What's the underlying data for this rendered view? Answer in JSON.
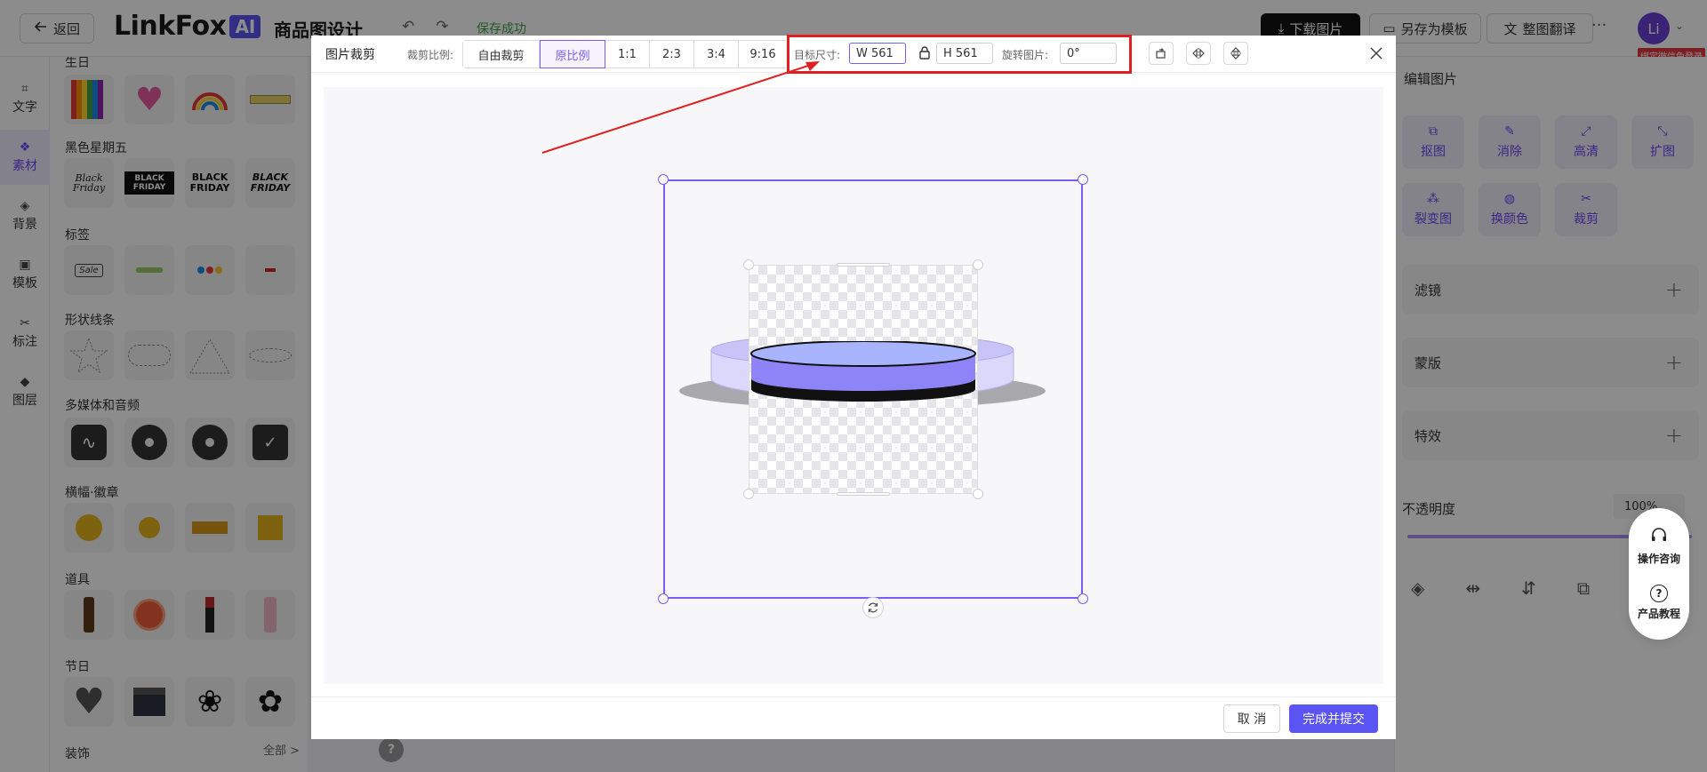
{
  "header": {
    "back_label": "返回",
    "logo_text": "LinkFox",
    "logo_badge": "AI",
    "app_title": "商品图设计",
    "save_status": "保存成功",
    "download_label": "下载图片",
    "save_template_label": "另存为模板",
    "translate_label": "整图翻译",
    "more_label": "···",
    "avatar_letter": "Li",
    "bind_badge": "绑定微信免登录"
  },
  "rail": {
    "items": [
      {
        "label": "文字",
        "icon": "text-icon"
      },
      {
        "label": "素材",
        "icon": "material-icon",
        "active": true
      },
      {
        "label": "背景",
        "icon": "background-icon"
      },
      {
        "label": "模板",
        "icon": "template-icon"
      },
      {
        "label": "标注",
        "icon": "annotate-icon"
      },
      {
        "label": "图层",
        "icon": "layers-icon"
      }
    ]
  },
  "assets": {
    "categories": [
      "生日",
      "黑色星期五",
      "标签",
      "形状线条",
      "多媒体和音频",
      "横幅·徽章",
      "道具",
      "节日",
      "装饰"
    ],
    "footer_all": "全部 >",
    "black_friday_text": "BLACK FRIDAY",
    "black_friday_script": "Black Friday",
    "sale_tag": "Sale"
  },
  "right_panel": {
    "title": "编辑图片",
    "tools": [
      "抠图",
      "消除",
      "高清",
      "扩图",
      "裂变图",
      "换颜色",
      "裁剪"
    ],
    "accordions": [
      "滤镜",
      "蒙版",
      "特效"
    ],
    "opacity_label": "不透明度",
    "opacity_value": "100%"
  },
  "float_help": {
    "consult_label": "操作咨询",
    "tutorial_label": "产品教程"
  },
  "crop_modal": {
    "title": "图片裁剪",
    "ratio_label": "裁剪比例:",
    "ratios": [
      "自由裁剪",
      "原比例",
      "1:1",
      "2:3",
      "3:4",
      "9:16"
    ],
    "active_ratio": "原比例",
    "target_size_label": "目标尺寸:",
    "width_value": "W 561",
    "height_value": "H 561",
    "rotate_label": "旋转图片:",
    "rotate_value": "0°",
    "cancel_label": "取 消",
    "submit_label": "完成并提交"
  },
  "colors": {
    "accent": "#7c5cf5",
    "primary_button": "#5b54f5",
    "highlight_box": "#e02020",
    "overlay": "rgba(0,0,0,0.45)"
  }
}
